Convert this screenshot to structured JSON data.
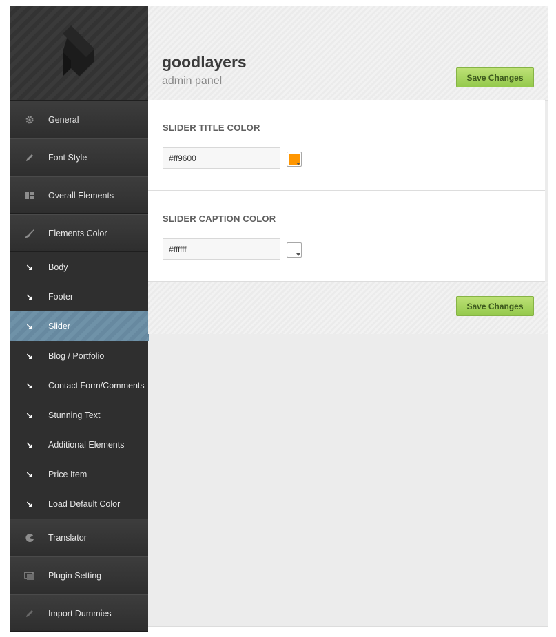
{
  "brand": {
    "title": "goodlayers",
    "subtitle": "admin panel"
  },
  "actions": {
    "save_label": "Save Changes"
  },
  "sidebar": {
    "items": [
      {
        "label": "General",
        "icon": "gear-icon"
      },
      {
        "label": "Font Style",
        "icon": "pencil-icon"
      },
      {
        "label": "Overall Elements",
        "icon": "layout-icon"
      },
      {
        "label": "Elements Color",
        "icon": "brush-icon"
      }
    ],
    "sub_items": [
      {
        "label": "Body"
      },
      {
        "label": "Footer"
      },
      {
        "label": "Slider",
        "active": true
      },
      {
        "label": "Blog / Portfolio"
      },
      {
        "label": "Contact Form/Comments"
      },
      {
        "label": "Stunning Text"
      },
      {
        "label": "Additional Elements"
      },
      {
        "label": "Price Item"
      },
      {
        "label": "Load Default Color"
      }
    ],
    "bottom_items": [
      {
        "label": "Translator",
        "icon": "translator-icon"
      },
      {
        "label": "Plugin Setting",
        "icon": "plugin-icon"
      },
      {
        "label": "Import Dummies",
        "icon": "pencil-icon"
      }
    ]
  },
  "settings": {
    "slider_title_color": {
      "label": "SLIDER TITLE COLOR",
      "value": "#ff9600",
      "swatch": "#ff9600"
    },
    "slider_caption_color": {
      "label": "SLIDER CAPTION COLOR",
      "value": "#ffffff",
      "swatch": "#ffffff"
    }
  }
}
